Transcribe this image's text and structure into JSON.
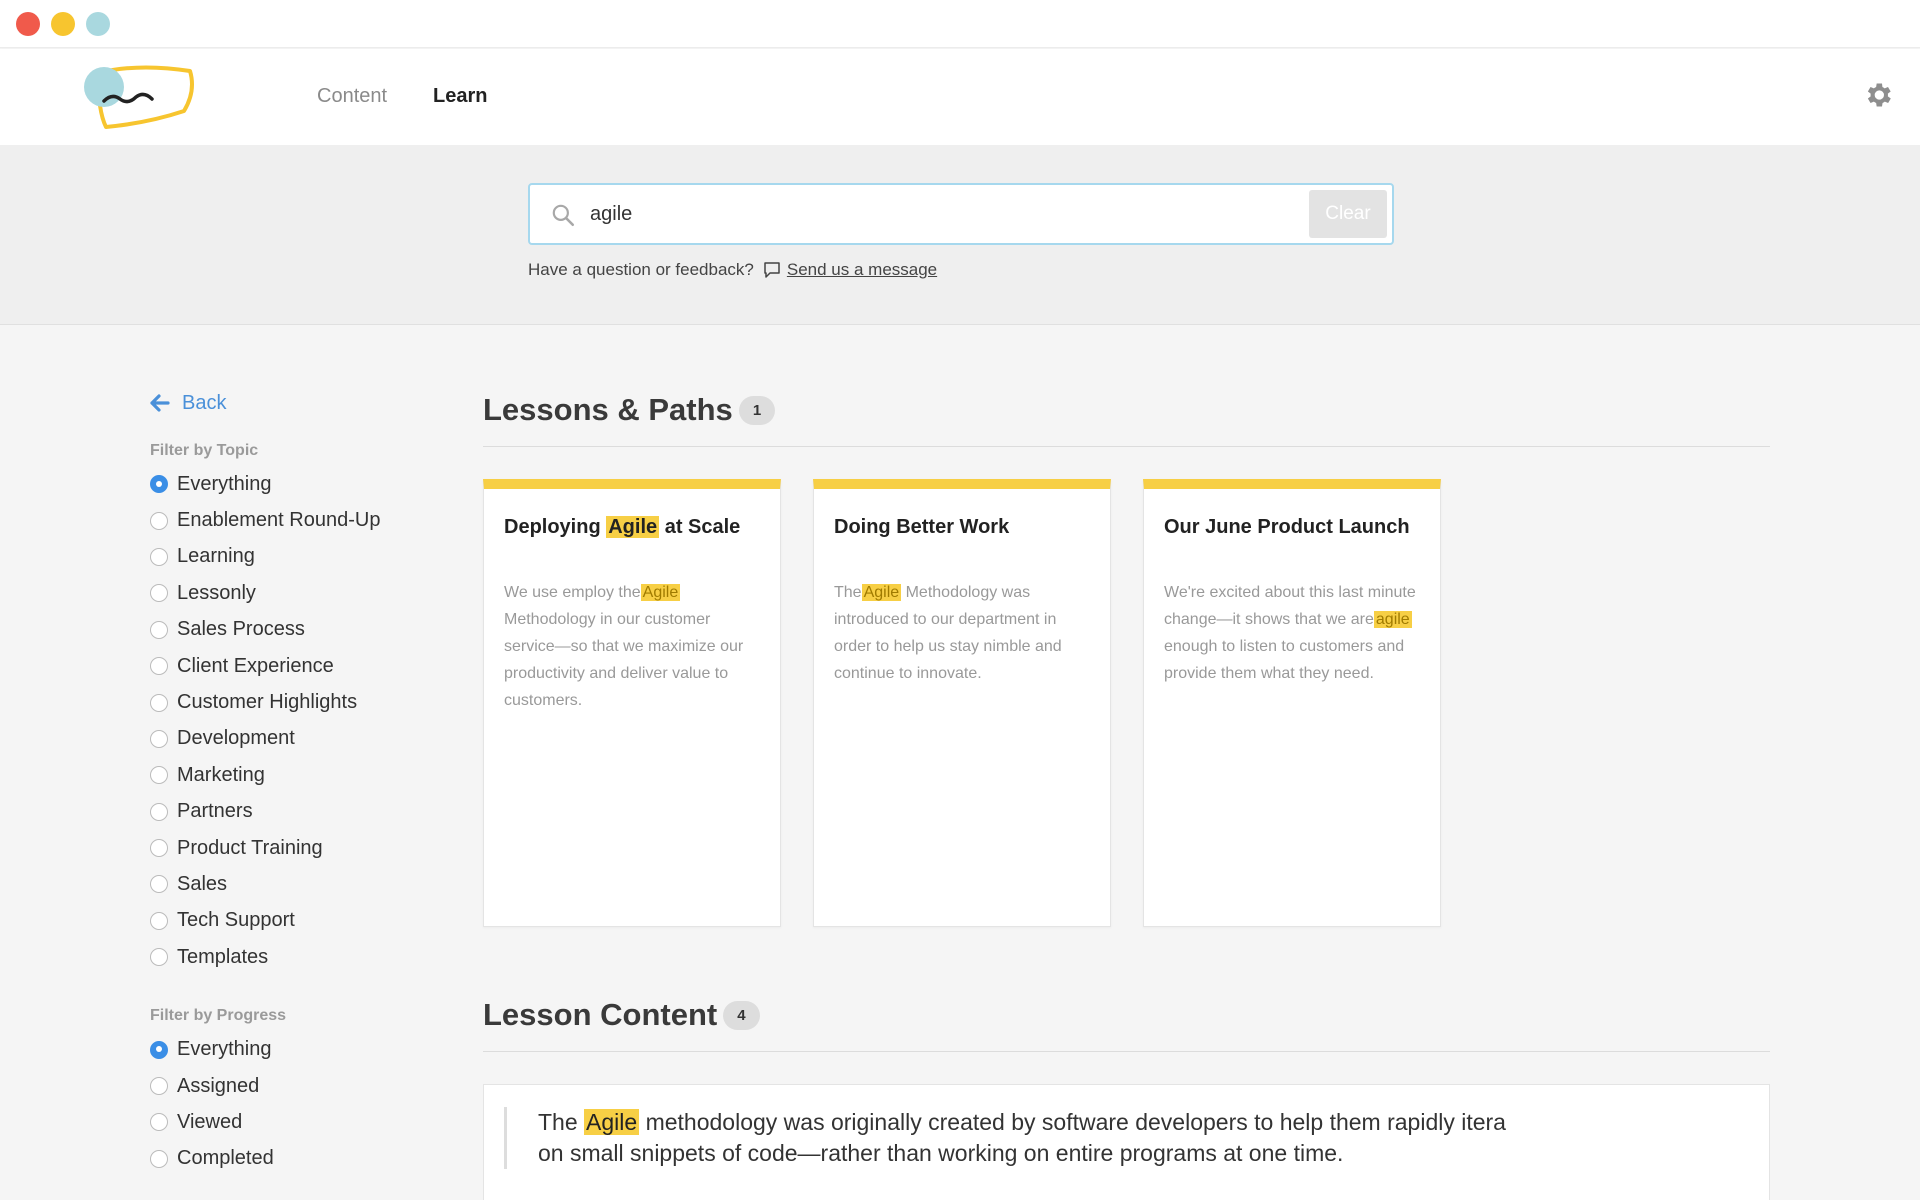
{
  "colors": {
    "accent_blue": "#3a8ee6",
    "highlight_yellow": "#f7cf45",
    "logo_teal": "#a9d8df"
  },
  "window_controls": [
    "close",
    "minimize",
    "maximize"
  ],
  "nav": {
    "content": "Content",
    "learn": "Learn",
    "active": "Learn"
  },
  "search": {
    "value": "agile",
    "placeholder": "",
    "clear_label": "Clear"
  },
  "feedback": {
    "prompt": "Have a question or feedback?",
    "link": "Send us a message"
  },
  "sidebar": {
    "back_label": "Back",
    "topic_heading": "Filter by Topic",
    "topics": [
      "Everything",
      "Enablement Round-Up",
      "Learning",
      "Lessonly",
      "Sales Process",
      "Client Experience",
      "Customer Highlights",
      "Development",
      "Marketing",
      "Partners",
      "Product Training",
      "Sales",
      "Tech Support",
      "Templates"
    ],
    "topic_selected": "Everything",
    "progress_heading": "Filter by Progress",
    "progress": [
      "Everything",
      "Assigned",
      "Viewed",
      "Completed"
    ],
    "progress_selected": "Everything"
  },
  "lessons_paths": {
    "title": "Lessons & Paths",
    "count": "1",
    "cards": [
      {
        "title_pre": "Deploying ",
        "title_hl": "Agile",
        "title_post": " at Scale",
        "body_pre": "We use employ the",
        "body_hl": "Agile",
        "body_post": " Methodology in our customer service—so that we maximize our productivity and deliver value to customers."
      },
      {
        "title_pre": "Doing Better Work",
        "title_hl": "",
        "title_post": "",
        "body_pre": "The",
        "body_hl": "Agile",
        "body_post": " Methodology was introduced to our department in order to help us stay nimble and continue to innovate."
      },
      {
        "title_pre": "Our June Product Launch",
        "title_hl": "",
        "title_post": "",
        "body_pre": "We're excited about this last minute change—it shows that we are",
        "body_hl": "agile",
        "body_post": " enough to listen to customers and provide them what they need."
      }
    ]
  },
  "lesson_content": {
    "title": "Lesson Content",
    "count": "4",
    "items": [
      {
        "pre": "The ",
        "hl": "Agile",
        "post": " methodology was originally created by software developers to help them rapidly itera",
        "line2": "on small snippets of code—rather than working on entire programs at one time."
      }
    ]
  }
}
